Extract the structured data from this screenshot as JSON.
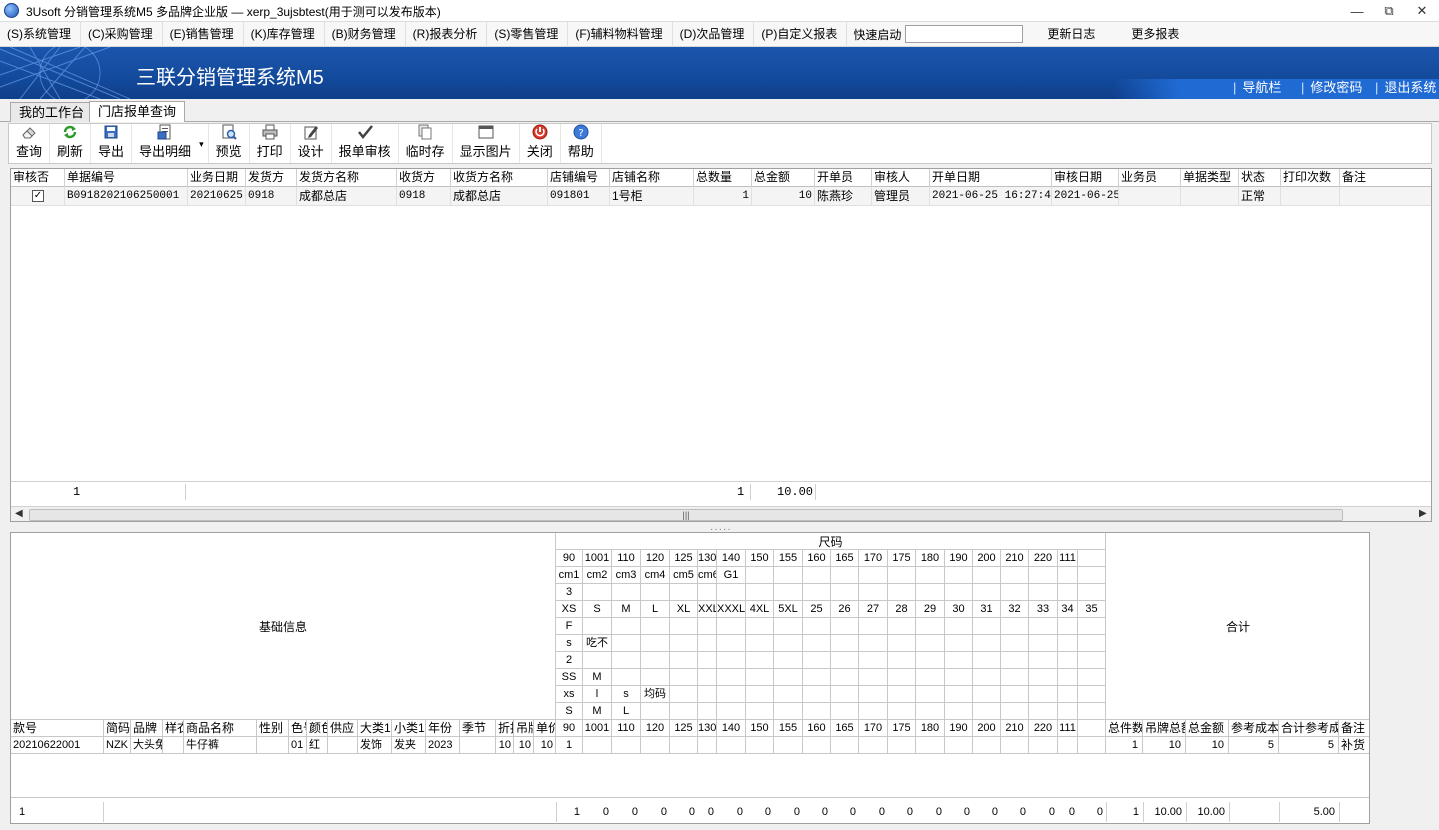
{
  "window": {
    "title": "3Usoft 分销管理系统M5 多品牌企业版 — xerp_3ujsbtest(用于测可以发布版本)",
    "minimize": "—",
    "restore": "⧉",
    "close": "✕"
  },
  "menu": {
    "items": [
      "(S)系统管理",
      "(C)采购管理",
      "(E)销售管理",
      "(K)库存管理",
      "(B)财务管理",
      "(R)报表分析",
      "(S)零售管理",
      "(F)辅料物料管理",
      "(D)次品管理",
      "(P)自定义报表"
    ],
    "quick_start_label": "快速启动",
    "quick_start_value": "",
    "update_log": "更新日志",
    "more_reports": "更多报表"
  },
  "banner": {
    "title": "三联分销管理系统M5",
    "links": [
      "导航栏",
      "修改密码",
      "退出系统"
    ]
  },
  "tabs": [
    "我的工作台",
    "门店报单查询"
  ],
  "toolbar": {
    "buttons": [
      "查询",
      "刷新",
      "导出",
      "导出明细",
      "预览",
      "打印",
      "设计",
      "报单审核",
      "临时存",
      "显示图片",
      "关闭",
      "帮助"
    ],
    "dropdown_arrow": "▾"
  },
  "main_grid": {
    "columns": [
      "审核否",
      "单据编号",
      "业务日期",
      "发货方",
      "发货方名称",
      "收货方",
      "收货方名称",
      "店铺编号",
      "店铺名称",
      "总数量",
      "总金额",
      "开单员",
      "审核人",
      "开单日期",
      "审核日期",
      "业务员",
      "单据类型",
      "状态",
      "打印次数",
      "备注"
    ],
    "rows": [
      {
        "checked": "✓",
        "doc_no": "B0918202106250001",
        "biz_date": "20210625",
        "sender": "0918",
        "sender_name": "成都总店",
        "receiver": "0918",
        "receiver_name": "成都总店",
        "shop_no": "091801",
        "shop_name": "1号柜",
        "total_qty": "1",
        "total_amount": "10",
        "creator": "陈燕珍",
        "reviewer": "管理员",
        "create_date": "2021-06-25 16:27:41",
        "review_date": "2021-06-25",
        "salesman": "",
        "doc_type": "",
        "status": "正常",
        "print_count": "",
        "remark": ""
      }
    ],
    "footer": {
      "count": "1",
      "total_qty": "1",
      "total_amount": "10.00"
    },
    "scroll_left": "◀",
    "scroll_right": "▶",
    "scroll_grip": "|||"
  },
  "detail_grid": {
    "size_group_label": "尺码",
    "basic_info_label": "基础信息",
    "total_label": "合计",
    "size_rows": [
      [
        "90",
        "1001",
        "110",
        "120",
        "125",
        "130",
        "140",
        "150",
        "155",
        "160",
        "165",
        "170",
        "175",
        "180",
        "190",
        "200",
        "210",
        "220",
        "111",
        ""
      ],
      [
        "cm1",
        "cm2",
        "cm3",
        "cm4",
        "cm5",
        "cm6",
        "G1",
        "",
        "",
        "",
        "",
        "",
        "",
        "",
        "",
        "",
        "",
        "",
        "",
        ""
      ],
      [
        "3",
        "",
        "",
        "",
        "",
        "",
        "",
        "",
        "",
        "",
        "",
        "",
        "",
        "",
        "",
        "",
        "",
        "",
        "",
        ""
      ],
      [
        "XS",
        "S",
        "M",
        "L",
        "XL",
        "XXL",
        "XXXL",
        "4XL",
        "5XL",
        "25",
        "26",
        "27",
        "28",
        "29",
        "30",
        "31",
        "32",
        "33",
        "34",
        "35"
      ],
      [
        "F",
        "",
        "",
        "",
        "",
        "",
        "",
        "",
        "",
        "",
        "",
        "",
        "",
        "",
        "",
        "",
        "",
        "",
        "",
        ""
      ],
      [
        "s",
        "吃不",
        "",
        "",
        "",
        "",
        "",
        "",
        "",
        "",
        "",
        "",
        "",
        "",
        "",
        "",
        "",
        "",
        "",
        ""
      ],
      [
        "2",
        "",
        "",
        "",
        "",
        "",
        "",
        "",
        "",
        "",
        "",
        "",
        "",
        "",
        "",
        "",
        "",
        "",
        "",
        ""
      ],
      [
        "SS",
        "M",
        "",
        "",
        "",
        "",
        "",
        "",
        "",
        "",
        "",
        "",
        "",
        "",
        "",
        "",
        "",
        "",
        "",
        ""
      ],
      [
        "xs",
        "l",
        "s",
        "均码",
        "",
        "",
        "",
        "",
        "",
        "",
        "",
        "",
        "",
        "",
        "",
        "",
        "",
        "",
        "",
        ""
      ],
      [
        "S",
        "M",
        "L",
        "",
        "",
        "",
        "",
        "",
        "",
        "",
        "",
        "",
        "",
        "",
        "",
        "",
        "",
        "",
        "",
        ""
      ]
    ],
    "basic_columns": [
      "款号",
      "简码",
      "品牌",
      "样衣",
      "商品名称",
      "性别",
      "色号",
      "颜色",
      "供应",
      "大类1",
      "小类1",
      "年份",
      "季节",
      "折扣",
      "吊牌",
      "单价"
    ],
    "size_header": [
      "90",
      "1001",
      "110",
      "120",
      "125",
      "130",
      "140",
      "150",
      "155",
      "160",
      "165",
      "170",
      "175",
      "180",
      "190",
      "200",
      "210",
      "220",
      "111",
      ""
    ],
    "total_columns": [
      "总件数",
      "吊牌总额",
      "总金额",
      "参考成本",
      "合计参考成本",
      "备注"
    ],
    "rows": [
      {
        "style_no": "20210622001",
        "code": "NZK",
        "brand": "大头兔",
        "sample": "",
        "product_name": "牛仔裤",
        "gender": "",
        "color_no": "01",
        "color": "红",
        "supplier": "",
        "cat1": "发饰",
        "subcat1": "发夹",
        "year": "2023",
        "season": "",
        "discount": "10",
        "tag": "10",
        "price": "10",
        "sizes": [
          "1",
          "",
          "",
          "",
          "",
          "",
          "",
          "",
          "",
          "",
          "",
          "",
          "",
          "",
          "",
          "",
          "",
          "",
          "",
          ""
        ],
        "total_qty": "1",
        "tag_total": "10",
        "amount": "10",
        "ref_cost": "5",
        "total_ref_cost": "5",
        "remark": "补货"
      }
    ],
    "footer": {
      "count": "1",
      "sizes": [
        "1",
        "0",
        "0",
        "0",
        "0",
        "0",
        "0",
        "0",
        "0",
        "0",
        "0",
        "0",
        "0",
        "0",
        "0",
        "0",
        "0",
        "0",
        "0",
        "0"
      ],
      "total_qty": "1",
      "tag_total": "10.00",
      "amount": "10.00",
      "ref_cost": "",
      "total_ref_cost": "5.00"
    }
  }
}
